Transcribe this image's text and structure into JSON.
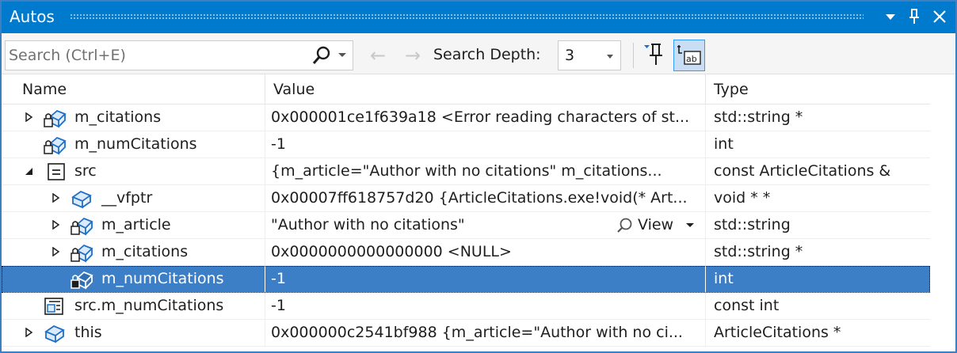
{
  "window": {
    "title": "Autos"
  },
  "toolbar": {
    "search_placeholder": "Search (Ctrl+E)",
    "search_depth_label": "Search Depth:",
    "search_depth_value": "3"
  },
  "columns": {
    "name": "Name",
    "value": "Value",
    "type": "Type"
  },
  "rows": [
    {
      "name": "m_citations",
      "value": "0x000001ce1f639a18 <Error reading characters of st...",
      "type": "std::string *"
    },
    {
      "name": "m_numCitations",
      "value": "-1",
      "type": "int"
    },
    {
      "name": "src",
      "value": "{m_article=\"Author with no citations\" m_citations...",
      "type": "const ArticleCitations &"
    },
    {
      "name": "__vfptr",
      "value": "0x00007ff618757d20 {ArticleCitations.exe!void(* Art...",
      "type": "void * *"
    },
    {
      "name": "m_article",
      "value": "\"Author with no citations\"",
      "type": "std::string",
      "view_label": "View"
    },
    {
      "name": "m_citations",
      "value": "0x0000000000000000 <NULL>",
      "type": "std::string *"
    },
    {
      "name": "m_numCitations",
      "value": "-1",
      "type": "int"
    },
    {
      "name": "src.m_numCitations",
      "value": "-1",
      "type": "const int"
    },
    {
      "name": "this",
      "value": "0x000000c2541bf988 {m_article=\"Author with no ci...",
      "type": "ArticleCitations *"
    }
  ],
  "colors": {
    "title_bar": "#007acc",
    "selection": "#3d7fc7",
    "icon_blue": "#1f6fc5"
  }
}
